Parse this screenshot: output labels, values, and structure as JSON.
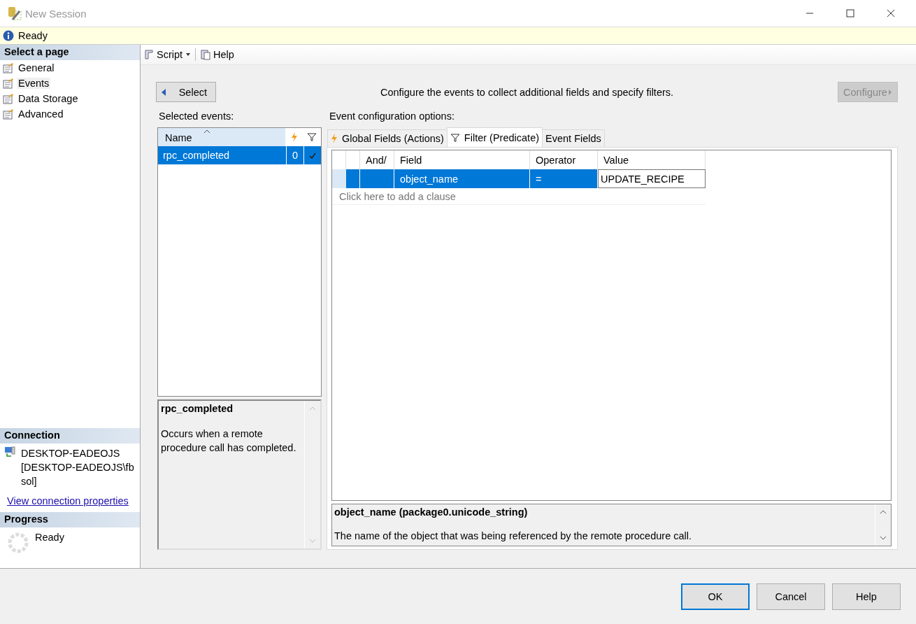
{
  "window": {
    "title": "New Session"
  },
  "status": {
    "text": "Ready"
  },
  "sidebar": {
    "header": "Select a page",
    "items": [
      {
        "label": "General",
        "selected": false
      },
      {
        "label": "Events",
        "selected": true
      },
      {
        "label": "Data Storage",
        "selected": false
      },
      {
        "label": "Advanced",
        "selected": false
      }
    ]
  },
  "connection": {
    "header": "Connection",
    "server": "DESKTOP-EADEOJS",
    "user": "[DESKTOP-EADEOJS\\fbsol]",
    "link": "View connection properties"
  },
  "progress": {
    "header": "Progress",
    "status": "Ready"
  },
  "toolbar": {
    "script": "Script",
    "help": "Help"
  },
  "select_button": "Select",
  "instructions": "Configure the events to collect additional fields and specify filters.",
  "configure_button": {
    "label": "Configure",
    "disabled": true
  },
  "selected_events": {
    "label": "Selected events:",
    "column": "Name",
    "rows": [
      {
        "name": "rpc_completed",
        "count": "0",
        "filtered": true,
        "selected": true
      }
    ]
  },
  "event_description": {
    "title": "rpc_completed",
    "text": "Occurs when a remote procedure call has completed."
  },
  "config": {
    "label": "Event configuration options:",
    "tabs": [
      {
        "label": "Global Fields (Actions)",
        "kind": "actions",
        "selected": false
      },
      {
        "label": "Filter (Predicate)",
        "kind": "filter",
        "selected": true
      },
      {
        "label": "Event Fields",
        "kind": "plain",
        "selected": false
      }
    ]
  },
  "filter_grid": {
    "columns": [
      "And/",
      "Field",
      "Operator",
      "Value"
    ],
    "rows": [
      {
        "and_or": "",
        "field": "object_name",
        "operator": "=",
        "value": "UPDATE_RECIPE",
        "selected": true
      }
    ],
    "add_hint": "Click here to add a clause"
  },
  "field_description": {
    "title": "object_name (package0.unicode_string)",
    "text": "The name of the object that was being referenced by the remote procedure call."
  },
  "buttons": [
    {
      "label": "OK",
      "default": true
    },
    {
      "label": "Cancel",
      "default": false
    },
    {
      "label": "Help",
      "default": false
    }
  ]
}
